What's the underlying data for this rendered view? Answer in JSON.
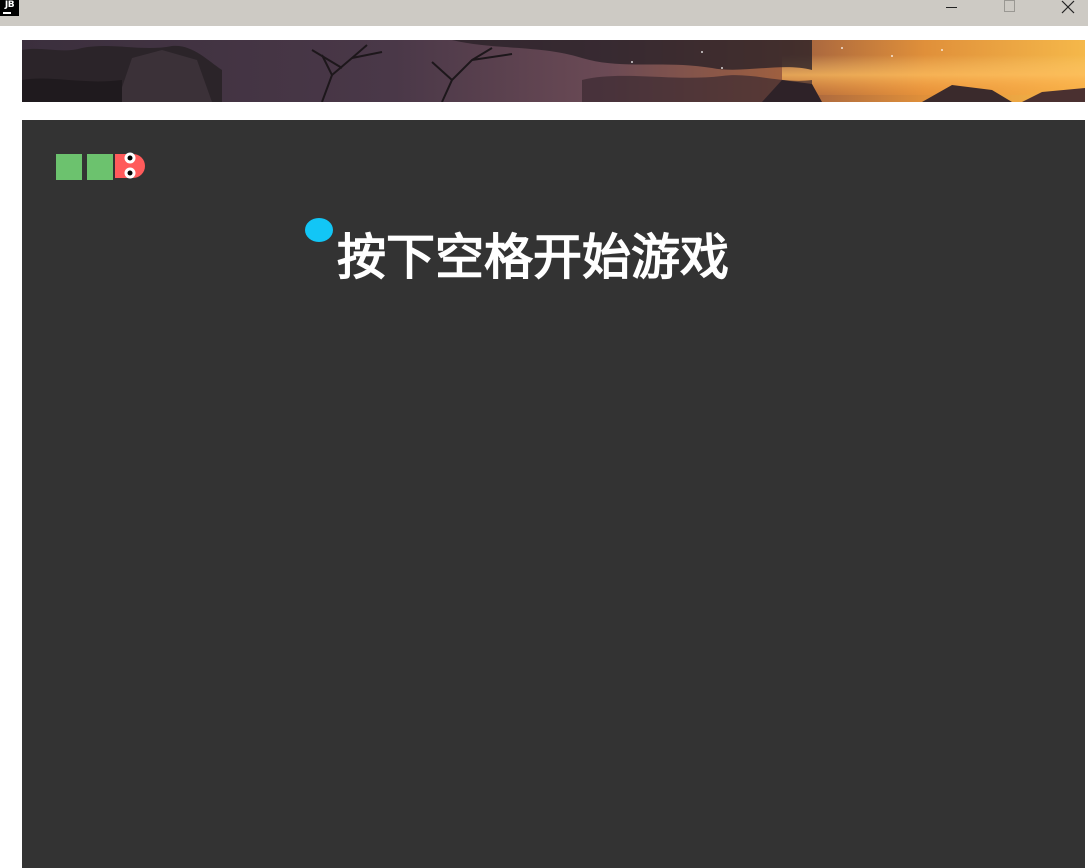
{
  "window": {
    "app_icon_text": "JB",
    "icons": {
      "minimize": "minimize-icon",
      "maximize": "maximize-icon",
      "close": "close-icon"
    },
    "titlebar_color": "#cdcac4"
  },
  "banner": {
    "image": "landscape-banner-image"
  },
  "game": {
    "board_color": "#333333",
    "prompt": "按下空格开始游戏",
    "snake": {
      "body_segments": 2,
      "body_color": "#6cc26e",
      "head_color": "#ff5b5b",
      "direction": "right"
    },
    "food_color": "#12c6f6"
  }
}
